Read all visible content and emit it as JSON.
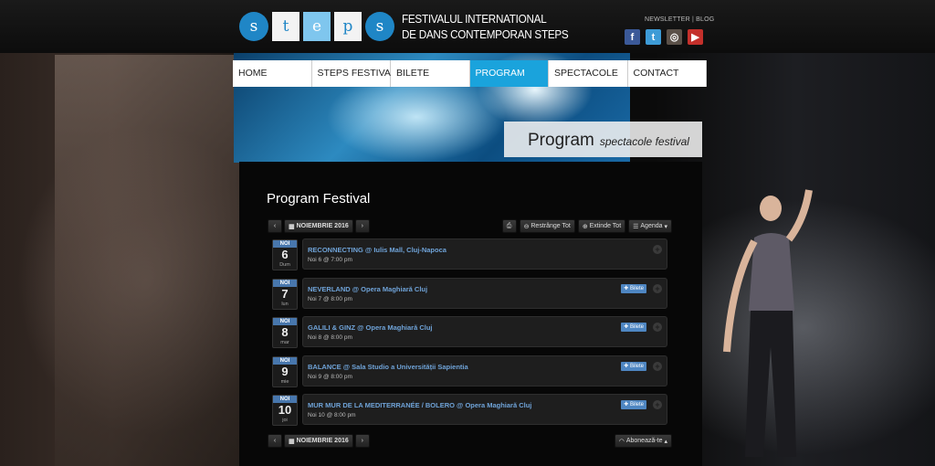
{
  "header": {
    "logo_letters": [
      "s",
      "t",
      "e",
      "p",
      "s"
    ],
    "logo_line1": "FESTIVALUL INTERNATIONAL",
    "logo_line2": "DE DANS CONTEMPORAN STEPS",
    "links": [
      "NEWSLETTER",
      "BLOG"
    ],
    "social": [
      "facebook-icon",
      "twitter-icon",
      "instagram-icon",
      "youtube-icon"
    ]
  },
  "nav": {
    "items": [
      "HOME",
      "STEPS FESTIVAL",
      "BILETE",
      "PROGRAM",
      "SPECTACOLE",
      "CONTACT"
    ],
    "active": "PROGRAM"
  },
  "banner": {
    "caption_big": "Program",
    "caption_small": "spectacole festival"
  },
  "main": {
    "title": "Program Festival",
    "calendar": {
      "month_label": "NOIEMBRIE 2016",
      "collapse_label": "Restrânge Tot",
      "expand_label": "Extinde Tot",
      "view_label": "Agenda",
      "subscribe_label": "Abonează-te"
    },
    "events": [
      {
        "month": "NOI",
        "day": "6",
        "weekday": "Dum",
        "title": "RECONNECTING @ Iulis Mall, Cluj-Napoca",
        "time": "Noi 6 @ 7:00 pm",
        "ticket": ""
      },
      {
        "month": "NOI",
        "day": "7",
        "weekday": "lun",
        "title": "NEVERLAND @ Opera Maghiară Cluj",
        "time": "Noi 7 @ 8:00 pm",
        "ticket": "Bilete"
      },
      {
        "month": "NOI",
        "day": "8",
        "weekday": "mar",
        "title": "GALILI & GINZ @ Opera Maghiară Cluj",
        "time": "Noi 8 @ 8:00 pm",
        "ticket": "Bilete"
      },
      {
        "month": "NOI",
        "day": "9",
        "weekday": "mie",
        "title": "BALANCE @ Sala Studio a Universității Sapientia",
        "time": "Noi 9 @ 8:00 pm",
        "ticket": "Bilete"
      },
      {
        "month": "NOI",
        "day": "10",
        "weekday": "joi",
        "title": "MUR MUR DE LA MEDITERRANÉE / BOLERO @ Opera Maghiară Cluj",
        "time": "Noi 10 @ 8:00 pm",
        "ticket": "Bilete"
      }
    ]
  },
  "colors": {
    "accent": "#1aa3dc",
    "link": "#6fa3d8",
    "ticket": "#4e86c2"
  }
}
